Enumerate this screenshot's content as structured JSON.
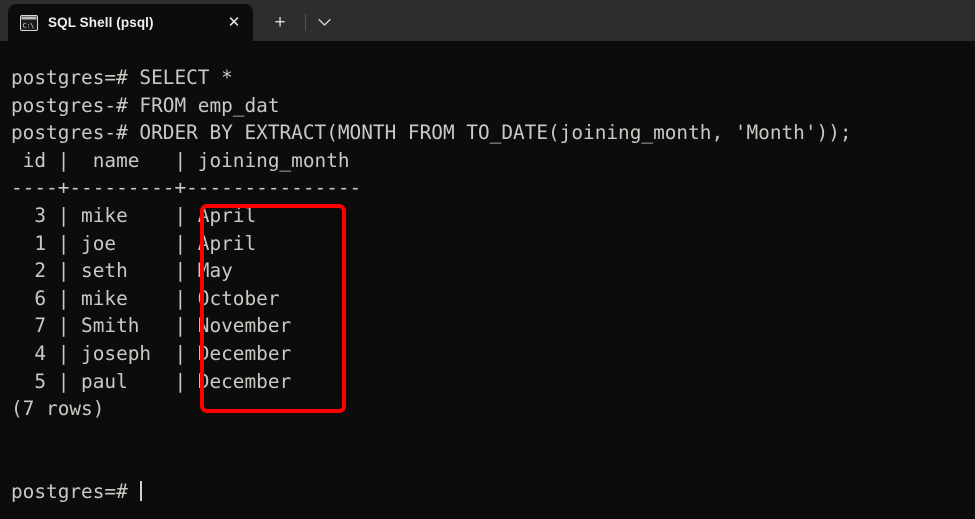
{
  "window": {
    "title": "SQL Shell (psql)",
    "background": "#0c0c0c",
    "tabbar_background": "#2d2d2d"
  },
  "tabstrip": {
    "tab_icon_name": "console-icon",
    "tab_label": "SQL Shell (psql)",
    "close_label": "✕",
    "new_tab_label": "+",
    "dropdown_label": "⌄"
  },
  "terminal": {
    "lines": [
      "postgres=# SELECT *",
      "postgres-# FROM emp_dat",
      "postgres-# ORDER BY EXTRACT(MONTH FROM TO_DATE(joining_month, 'Month'));",
      " id |  name   | joining_month",
      "----+---------+---------------",
      "  3 | mike    | April",
      "  1 | joe     | April",
      "  2 | seth    | May",
      "  6 | mike    | October",
      "  7 | Smith   | November",
      "  4 | joseph  | December",
      "  5 | paul    | December",
      "(7 rows)"
    ],
    "blank_lines_after": 2,
    "prompt": "postgres=# ",
    "text_color": "#ccc9c4"
  },
  "query": {
    "statement_lines": [
      "SELECT *",
      "FROM emp_dat",
      "ORDER BY EXTRACT(MONTH FROM TO_DATE(joining_month, 'Month'));"
    ],
    "prompt_primary": "postgres=#",
    "prompt_continuation": "postgres-#"
  },
  "result_table": {
    "columns": [
      "id",
      "name",
      "joining_month"
    ],
    "rows": [
      {
        "id": "3",
        "name": "mike",
        "joining_month": "April"
      },
      {
        "id": "1",
        "name": "joe",
        "joining_month": "April"
      },
      {
        "id": "2",
        "name": "seth",
        "joining_month": "May"
      },
      {
        "id": "6",
        "name": "mike",
        "joining_month": "October"
      },
      {
        "id": "7",
        "name": "Smith",
        "joining_month": "November"
      },
      {
        "id": "4",
        "name": "joseph",
        "joining_month": "December"
      },
      {
        "id": "5",
        "name": "paul",
        "joining_month": "December"
      }
    ],
    "row_count_text": "(7 rows)"
  },
  "annotation": {
    "name": "joining-month-column-highlight",
    "color": "#fe0000"
  }
}
